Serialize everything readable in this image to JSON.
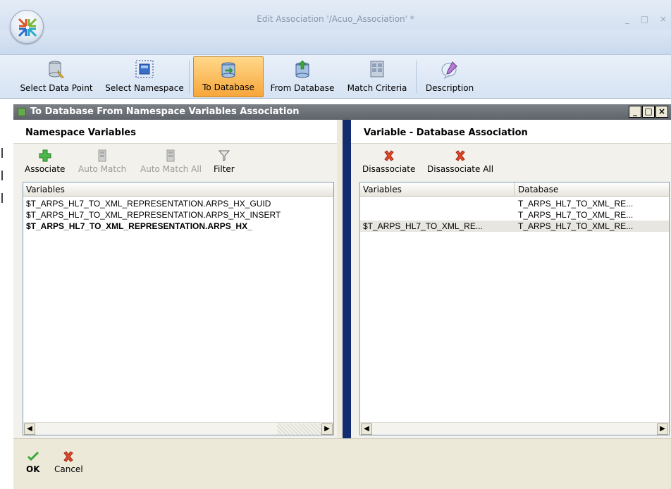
{
  "window": {
    "title": "Edit Association '/Acuo_Association' *",
    "controls": "_ □ ×"
  },
  "ribbon": {
    "buttons": [
      {
        "label": "Select Data Point",
        "icon": "database-point-icon"
      },
      {
        "label": "Select Namespace",
        "icon": "namespace-icon"
      },
      {
        "label": "To Database",
        "icon": "to-database-icon",
        "active": true
      },
      {
        "label": "From Database",
        "icon": "from-database-icon"
      },
      {
        "label": "Match Criteria",
        "icon": "match-criteria-icon"
      },
      {
        "label": "Description",
        "icon": "description-icon"
      }
    ]
  },
  "mdi": {
    "title": "To Database From Namespace Variables Association",
    "controls": [
      "_",
      "□",
      "×"
    ]
  },
  "left_pane": {
    "header": "Namespace Variables",
    "toolbar": {
      "associate": "Associate",
      "auto_match": "Auto Match",
      "auto_match_all": "Auto Match All",
      "filter": "Filter"
    },
    "grid": {
      "columns": [
        "Variables"
      ],
      "rows": [
        "$T_ARPS_HL7_TO_XML_REPRESENTATION.ARPS_HX_GUID",
        "$T_ARPS_HL7_TO_XML_REPRESENTATION.ARPS_HX_INSERT",
        "$T_ARPS_HL7_TO_XML_REPRESENTATION.ARPS_HX_"
      ]
    }
  },
  "right_pane": {
    "header": "Variable - Database Association",
    "toolbar": {
      "disassociate": "Disassociate",
      "disassociate_all": "Disassociate All"
    },
    "grid": {
      "columns": [
        "Variables",
        "Database"
      ],
      "rows": [
        {
          "variable": "",
          "database": "T_ARPS_HL7_TO_XML_RE..."
        },
        {
          "variable": "",
          "database": "T_ARPS_HL7_TO_XML_RE..."
        },
        {
          "variable": "$T_ARPS_HL7_TO_XML_RE...",
          "database": "T_ARPS_HL7_TO_XML_RE..."
        }
      ]
    }
  },
  "bottom": {
    "ok": "OK",
    "cancel": "Cancel"
  },
  "colors": {
    "active_ribbon": "#f7a63a",
    "divider": "#142c70",
    "mdi_title": "#6b6f76"
  }
}
